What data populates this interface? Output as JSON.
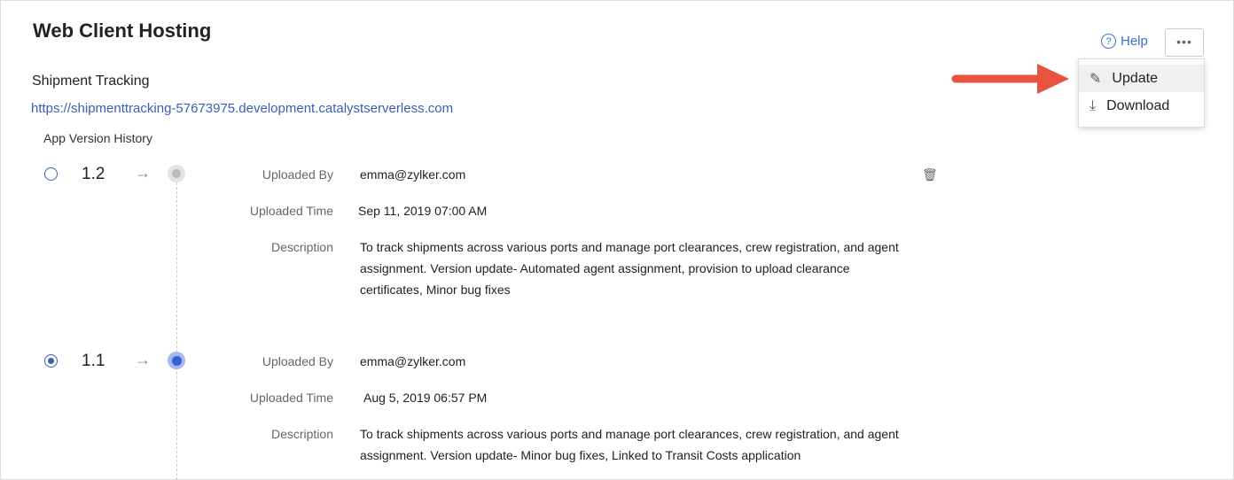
{
  "title": "Web Client Hosting",
  "app_name": "Shipment Tracking",
  "app_url": "https://shipmenttracking-57673975.development.catalystserverless.com",
  "section_title": "App Version History",
  "header": {
    "help_label": "Help",
    "help_icon": "question-circle-icon",
    "more_icon": "ellipsis-icon",
    "more_label": "•••"
  },
  "menu": {
    "items": [
      {
        "label": "Update",
        "icon": "pencil-icon"
      },
      {
        "label": "Download",
        "icon": "download-icon"
      }
    ]
  },
  "labels": {
    "uploaded_by": "Uploaded By",
    "uploaded_time": "Uploaded Time",
    "description": "Description"
  },
  "versions": [
    {
      "version": "1.2",
      "selected": false,
      "uploaded_by": "emma@zylker.com",
      "uploaded_time": "Sep 11, 2019 07:00 AM",
      "description": "To track shipments across various ports and manage port clearances, crew registration, and agent assignment. Version update- Automated agent assignment, provision to upload clearance certificates, Minor bug fixes"
    },
    {
      "version": "1.1",
      "selected": true,
      "uploaded_by": "emma@zylker.com",
      "uploaded_time": "Aug 5, 2019 06:57 PM",
      "description": "To track shipments across various ports and manage port clearances, crew registration, and agent assignment. Version update- Minor bug fixes, Linked to Transit Costs application"
    }
  ],
  "colors": {
    "accent": "#3461d6",
    "annotation_arrow": "#e8533f"
  }
}
